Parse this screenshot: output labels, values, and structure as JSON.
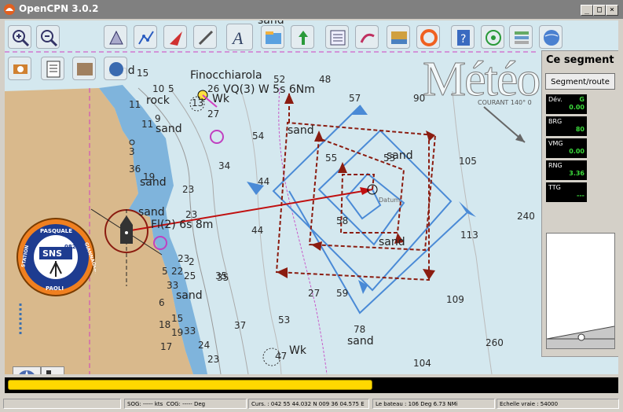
{
  "window": {
    "title": "OpenCPN 3.0.2",
    "minimize": "_",
    "maximize": "□",
    "close": "×"
  },
  "watermark": "Météo",
  "segment_panel": {
    "title": "Ce segment",
    "button": "Segment/route",
    "items": [
      {
        "label": "Dév.",
        "value": "0.00",
        "unit": "G"
      },
      {
        "label": "BRG",
        "value": "80"
      },
      {
        "label": "VMG",
        "value": "0.00"
      },
      {
        "label": "RNG",
        "value": "3.36"
      },
      {
        "label": "TTG",
        "value": "---"
      }
    ]
  },
  "chart": {
    "place": "Finocchiarola",
    "light_label": "VQ(3) W 5s 6Nm",
    "light_label2": "Fl(2) 6s 8m",
    "datum": "Datum",
    "current": "COURANT 140° 0",
    "sand": "sand",
    "rock": "rock",
    "wk": "Wk",
    "depths": [
      "13",
      "11",
      "9",
      "10",
      "15",
      "5",
      "11",
      "3",
      "36",
      "19",
      "34",
      "23",
      "23",
      "2",
      "27",
      "26",
      "22",
      "33",
      "25",
      "23",
      "44",
      "35",
      "54",
      "52",
      "48",
      "57",
      "90",
      "105",
      "240",
      "113",
      "109",
      "260",
      "53",
      "78",
      "104",
      "33",
      "24",
      "17",
      "15",
      "6",
      "35",
      "19",
      "23",
      "37",
      "27",
      "47",
      "44",
      "53",
      "55",
      "59",
      "58",
      "18",
      "5"
    ]
  },
  "logo": {
    "top": "PASQUALE",
    "right": "GIANNAGLIA",
    "left": "STATION",
    "bottom": "PAOLI",
    "sns": "SNS",
    "number": "082"
  },
  "progress": {
    "percent": 60
  },
  "status": {
    "sog": "SOG: ----- kts",
    "cog": "COG: ----- Deg",
    "curs": "Curs. : 042 55 44.032 N 009 36 04.575 E",
    "bateau": "Le bateau : 106 Deg    6.73 NMi",
    "echelle": "Echelle vraie :    54000"
  },
  "colors": {
    "sea": "#d4e8ef",
    "land": "#d9b98c",
    "shallow": "#7fb4dc",
    "route_blue": "#4a8ad6",
    "route_red": "#8b1c10",
    "progress": "#ffd800"
  },
  "toolbar_icons": [
    "zoom-in-icon",
    "zoom-out-icon",
    "chart-quilt-icon",
    "route-icon",
    "autofollow-icon",
    "measure-icon",
    "text-icon",
    "chart-open-icon",
    "sea-level-icon",
    "settings-icon",
    "route-manager-icon",
    "current-icon",
    "tide-icon",
    "mob-icon",
    "help-icon",
    "target-icon",
    "layers-icon",
    "globe-icon",
    "print-icon",
    "notes-icon",
    "photo-icon",
    "ais-icon"
  ]
}
